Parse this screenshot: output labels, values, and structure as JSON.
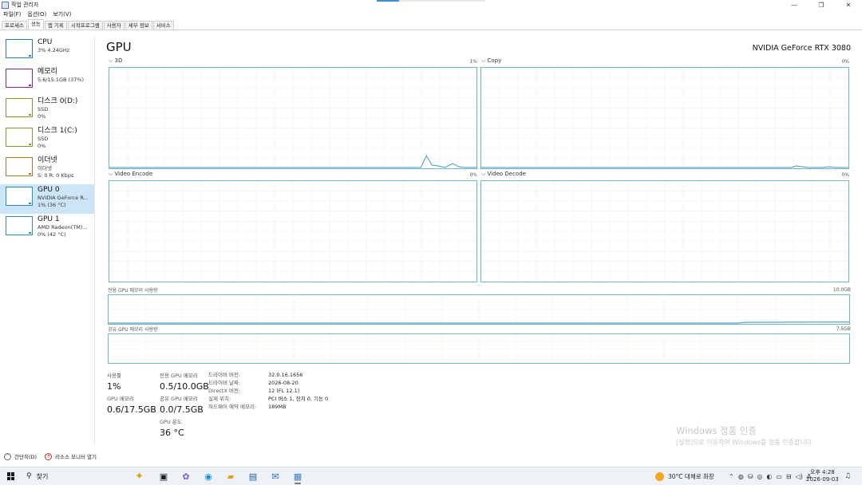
{
  "window": {
    "title": "작업 관리자",
    "controls": {
      "minimize": "—",
      "maximize": "❐",
      "close": "✕"
    }
  },
  "menu": [
    "파일(F)",
    "옵션(O)",
    "보기(V)"
  ],
  "tabs": [
    "프로세스",
    "성능",
    "앱 기록",
    "시작프로그램",
    "사용자",
    "세부 정보",
    "서비스"
  ],
  "active_tab": "성능",
  "sidebar": [
    {
      "name": "CPU",
      "sub1": "3% 4.24GHz",
      "sub2": "",
      "sub3": "",
      "color": "#1f7ab5"
    },
    {
      "name": "메모리",
      "sub1": "5.6/15.1GB (37%)",
      "sub2": "",
      "sub3": "",
      "color": "#8b2a8b"
    },
    {
      "name": "디스크 0(D:)",
      "sub1": "SSD",
      "sub2": "0%",
      "sub3": "",
      "color": "#7c9b2c"
    },
    {
      "name": "디스크 1(C:)",
      "sub1": "SSD",
      "sub2": "0%",
      "sub3": "",
      "color": "#7c9b2c"
    },
    {
      "name": "이더넷",
      "sub1": "이더넷",
      "sub2": "S: 0 R: 0 Kbps",
      "sub3": "",
      "color": "#a77b20"
    },
    {
      "name": "GPU 0",
      "sub1": "NVIDIA GeForce R...",
      "sub2": "1% (36 °C)",
      "sub3": "",
      "color": "#2a8fb5",
      "active": true
    },
    {
      "name": "GPU 1",
      "sub1": "AMD Radeon(TM)...",
      "sub2": "0% (42 °C)",
      "sub3": "",
      "color": "#2a8fb5"
    }
  ],
  "main": {
    "title": "GPU",
    "model": "NVIDIA GeForce RTX 3080",
    "engines": [
      {
        "label": "3D",
        "pct": "1%"
      },
      {
        "label": "Copy",
        "pct": "0%"
      },
      {
        "label": "Video Encode",
        "pct": "0%"
      },
      {
        "label": "Video Decode",
        "pct": "0%"
      }
    ],
    "dedicated_mem": {
      "label": "전용 GPU 메모리 사용량",
      "max": "10.0GB"
    },
    "shared_mem": {
      "label": "공유 GPU 메모리 사용량",
      "max": "7.5GB"
    },
    "stats": {
      "usage_label": "사용률",
      "usage_value": "1%",
      "gpu_mem_label": "GPU 메모리",
      "gpu_mem_value": "0.6/17.5GB",
      "ded_label": "전용 GPU 메모리",
      "ded_value": "0.5/10.0GB",
      "shared_label": "공유 GPU 메모리",
      "shared_value": "0.0/7.5GB",
      "temp_label": "GPU 온도",
      "temp_value": "36 °C"
    },
    "details": [
      {
        "key": "드라이버 버전:",
        "value": "32.0.16.1656"
      },
      {
        "key": "드라이버 날짜:",
        "value": "2026-08-20"
      },
      {
        "key": "DirectX 버전:",
        "value": "12 (FL 12.1)"
      },
      {
        "key": "실제 위치:",
        "value": "PCI 버스 1, 장치 0, 기능 0"
      },
      {
        "key": "하드웨어 예약 메모리:",
        "value": "189MB"
      }
    ]
  },
  "watermark": {
    "title": "Windows 정품 인증",
    "subtitle": "[설정]으로 이동하여 Windows를 정품 인증합니다."
  },
  "footer": {
    "simple": "간단히(D)",
    "resmon": "리소스 모니터 열기"
  },
  "taskbar": {
    "search_label": "찾기",
    "weather": "30°C 대체로 화창",
    "time": "오후 4:28",
    "date": "2026-09-03",
    "tray_ime": "A"
  }
}
